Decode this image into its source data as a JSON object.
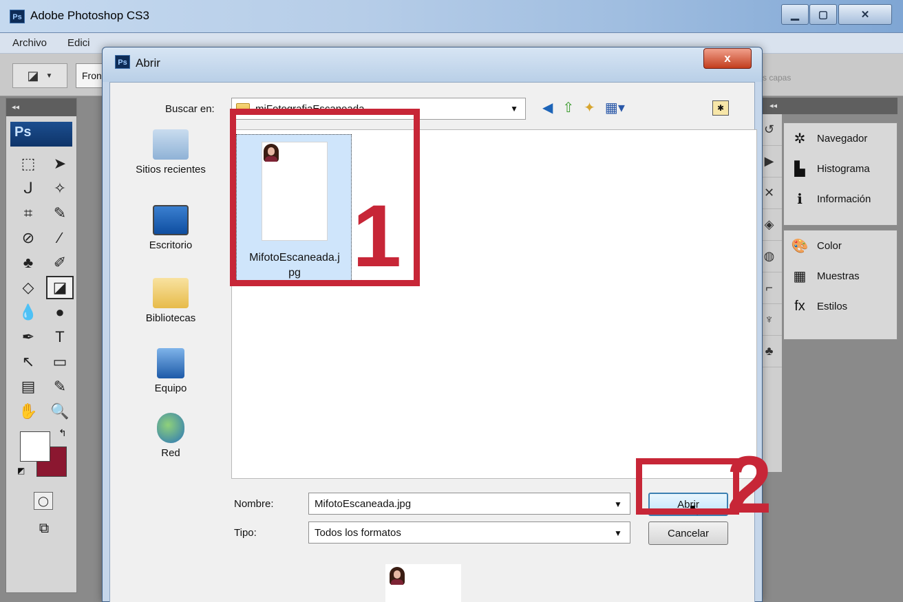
{
  "app": {
    "title": "Adobe Photoshop CS3",
    "logo": "Ps",
    "menus": [
      "Archivo",
      "Edici"
    ],
    "fill_source": "Fron",
    "layers_option": "s capas"
  },
  "toolbox": {
    "collapse": "◂◂",
    "brand": "Ps",
    "tools": [
      "marquee-icon",
      "move-icon",
      "lasso-icon",
      "magic-wand-icon",
      "crop-icon",
      "slice-icon",
      "healing-icon",
      "brush-icon",
      "stamp-icon",
      "history-brush-icon",
      "eraser-icon",
      "paint-bucket-icon",
      "blur-icon",
      "dodge-icon",
      "pen-icon",
      "type-icon",
      "path-select-icon",
      "shape-icon",
      "notes-icon",
      "eyedropper-icon",
      "hand-icon",
      "zoom-icon"
    ],
    "tool_glyphs": [
      "⬚",
      "➤",
      "ᒍ",
      "✧",
      "⌗",
      "✎",
      "⊘",
      "∕",
      "♣",
      "✐",
      "◇",
      "◪",
      "💧",
      "●",
      "✒",
      "T",
      "↖",
      "▭",
      "▤",
      "✎",
      "✋",
      "🔍"
    ],
    "active_tool_index": 11,
    "foreground_color": "#ffffff",
    "background_color": "#8b1730"
  },
  "panels": {
    "head": "◂◂",
    "group1": [
      {
        "icon": "navigator-icon",
        "glyph": "✲",
        "label": "Navegador"
      },
      {
        "icon": "histogram-icon",
        "glyph": "▙",
        "label": "Histograma"
      },
      {
        "icon": "info-icon",
        "glyph": "ℹ",
        "label": "Información"
      }
    ],
    "group2": [
      {
        "icon": "color-icon",
        "glyph": "🎨",
        "label": "Color"
      },
      {
        "icon": "swatches-icon",
        "glyph": "▦",
        "label": "Muestras"
      },
      {
        "icon": "styles-icon",
        "glyph": "fx",
        "label": "Estilos"
      }
    ]
  },
  "dialog": {
    "logo": "Ps",
    "title": "Abrir",
    "close": "x",
    "lookin_label": "Buscar en:",
    "lookin_value": "miFotografiaEscaneada",
    "places": [
      {
        "label": "Sitios recientes",
        "icon": "recent-places-icon"
      },
      {
        "label": "Escritorio",
        "icon": "desktop-icon"
      },
      {
        "label": "Bibliotecas",
        "icon": "libraries-icon"
      },
      {
        "label": "Equipo",
        "icon": "computer-icon"
      },
      {
        "label": "Red",
        "icon": "network-icon"
      }
    ],
    "file": {
      "name": "MifotoEscaneada.jpg",
      "name_line1": "MifotoEscaneada.j",
      "name_line2": "pg"
    },
    "name_label": "Nombre:",
    "name_value": "MifotoEscaneada.jpg",
    "type_label": "Tipo:",
    "type_value": "Todos los formatos",
    "open_button": "Abrir",
    "cancel_button": "Cancelar"
  },
  "annotations": {
    "one": "1",
    "two": "2",
    "color": "#c72637"
  }
}
